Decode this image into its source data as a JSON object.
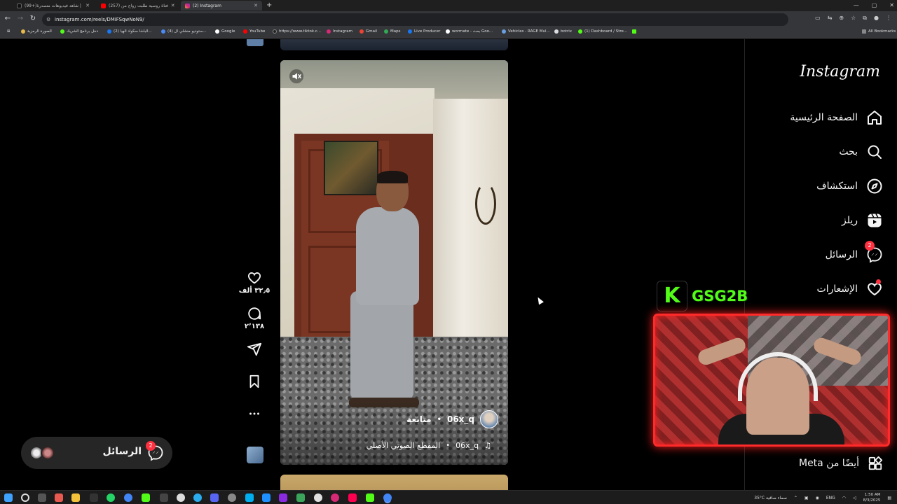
{
  "browser": {
    "tabs": [
      {
        "label": "(99+)شاهد فيديوهات متصدرة |",
        "active": false
      },
      {
        "label": "(257) فتاة روسية طلبت زواج من",
        "active": false
      },
      {
        "label": "(2) Instagram",
        "active": true
      }
    ],
    "new_tab": "+",
    "url": "instagram.com/reels/DMiFSqwNoN9/",
    "bookmarks": [
      "الصورة الرمزية",
      "دخل برنامج الشريك",
      "(2) الباشا سكواد الهيا...",
      "(4) ستوديو منشلي ال...",
      "Google",
      "YouTube",
      "https://www.tiktok.c...",
      "Instagram",
      "Gmail",
      "Maps",
      "Live Producer",
      "wormate - بحث Goo...",
      "Vehicles - RAGE Mul...",
      "botrix",
      "(1) Dashboard / Stre..."
    ],
    "all_bookmarks": "All Bookmarks"
  },
  "sidebar": {
    "logo": "Instagram",
    "items": [
      {
        "label": "الصفحة الرئيسية",
        "icon": "home-icon"
      },
      {
        "label": "بحث",
        "icon": "search-icon"
      },
      {
        "label": "استكشاف",
        "icon": "explore-icon"
      },
      {
        "label": "ريلز",
        "icon": "reels-icon"
      },
      {
        "label": "الرسائل",
        "icon": "messenger-icon",
        "badge": "2"
      },
      {
        "label": "الإشعارات",
        "icon": "heart-icon"
      }
    ],
    "meta": "أيضًا من Meta"
  },
  "reel": {
    "username": "06x_q",
    "follow": "متابعة",
    "audio_user": "06x_q",
    "audio_title": "المقطع الصوتي الأصلي",
    "likes": "٣٢٫٥ ألف",
    "comments": "٢٬١٣٨"
  },
  "messages_pill": {
    "label": "الرسائل",
    "badge": "2"
  },
  "stream": {
    "kick_logo": "K",
    "channel": "GSG2B"
  },
  "taskbar": {
    "weather": "35°C سماء صافية",
    "lang": "ENG",
    "time": "1:50 AM",
    "date": "8/3/2025"
  },
  "colors": {
    "accent_badge": "#ff3040",
    "kick_green": "#53fc18",
    "webcam_border": "#ff2a2a"
  }
}
